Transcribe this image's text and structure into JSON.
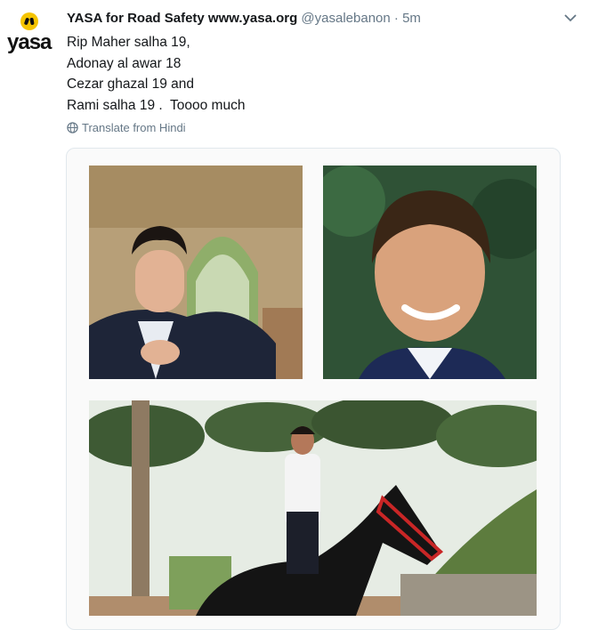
{
  "tweet": {
    "brand_text": "yasa",
    "author_name": "YASA for Road Safety www.yasa.org",
    "handle": "@yasalebanon",
    "separator": "·",
    "time": "5m",
    "lines": [
      "Rip Maher salha 19,",
      "Adonay al awar 18",
      "Cezar ghazal 19 and",
      "Rami salha 19 .  Toooo much"
    ],
    "translate_label": "Translate from Hindi"
  },
  "icons": {
    "avatar": "yasa-logo-icon",
    "more": "chevron-down-icon",
    "translate": "globe-icon"
  },
  "colors": {
    "brand_yellow": "#f5c400",
    "text": "#14171a",
    "muted": "#657786",
    "border": "#e1e8ed"
  }
}
